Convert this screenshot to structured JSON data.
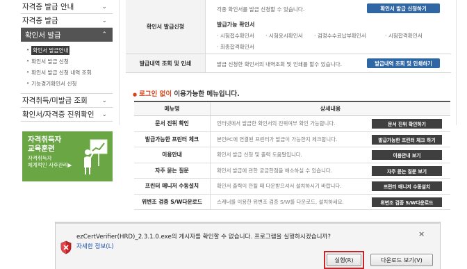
{
  "sidebar": {
    "items": [
      {
        "label": "자격증 발급 안내",
        "chevron": "⌄"
      },
      {
        "label": "자격증 발급",
        "chevron": "⌄"
      },
      {
        "label": "확인서 발급",
        "chevron": "⌃"
      }
    ],
    "sub_items": [
      "확인서 발급안내",
      "확인서 발급 신청",
      "확인서 발급 신청 내역 조회",
      "기능경기확인서 신청"
    ],
    "more_items": [
      {
        "label": "자격취득/미발급 조회",
        "chevron": "⌄"
      },
      {
        "label": "확인서/자격증 진위확인",
        "chevron": "⌄"
      }
    ],
    "banner": {
      "title_line1": "자격취득자",
      "title_line2": "교육훈련",
      "sub_line1": "자격취득자",
      "sub_line2": "체계적인 사후관리▶"
    }
  },
  "top_table": {
    "row1": {
      "head": "확인서 발급신청",
      "desc": "각종 확인서를 발급 신청할 수 있습니다.",
      "button": "확인서 발급 신청하기",
      "avail_label": "발급가능 확인서",
      "certs": [
        "· 시험접수확인서",
        "· 시험응시확인서",
        "· 검정수수료납부확인서",
        "· 시험합격확인서",
        "· 최종합격확인서"
      ]
    },
    "row2": {
      "head": "발급내역 조회 및 인쇄",
      "desc": "발급 신청한 확인서의 내역조회 및 인쇄를 할수 있습니다.",
      "button": "발급내역 조회 및 인쇄하기"
    }
  },
  "section": {
    "bullet": "●",
    "highlight": "로그인 없이",
    "rest": " 이용가능한 메뉴입니다."
  },
  "menu_table": {
    "col1": "메뉴명",
    "col2": "상세내용",
    "rows": [
      {
        "name": "문서 진위 확인",
        "desc": "인터넷에서 발급한 확인서의 진위여부 확인 가능합니다.",
        "button": "문서 진위 확인하기"
      },
      {
        "name": "발급가능한 프린터 체크",
        "desc": "본인PC에 연결된 프린터가 발급이 가능한지 체크합니다.",
        "button": "발급가능한 프린터 체크 하기"
      },
      {
        "name": "이용안내",
        "desc": "확인서 발급 신청 및 출력 도움말입니다.",
        "button": "이용안내 보기"
      },
      {
        "name": "자주 묻는 질문",
        "desc": "확인서 발급에 관한 궁금한점을 해소하실 수 있습니다.",
        "button": "자주 묻는 질문 보기"
      },
      {
        "name": "프린터 매니저 수동설치",
        "desc": "확인서 출력이 안될 때 다운받으셔서 설치하시기 바랍니다.",
        "button": "프린터 매니저 수동설치"
      },
      {
        "name": "위변조 검증 S/W다운로드",
        "desc": "스캐너를 이용한 위변조 검증 S/W를 다운로드, 설치하세요.",
        "button": "위변조 검증 S/W다운로드"
      }
    ]
  },
  "security_bar": {
    "message": "ezCertVerifier(HRD)_2.3.1.0.exe의 게시자를 확인할 수 없습니다. 프로그램을 실행하시겠습니까?",
    "link": "자세한 정보(L)",
    "run_button": "실행(R)",
    "view_button": "다운로드 보기(V)",
    "close": "×"
  },
  "colors": {
    "accent_blue": "#2f67a5",
    "highlight_orange": "#d5451b",
    "banner_green": "#6aa644",
    "run_border_red": "#c8252a"
  }
}
